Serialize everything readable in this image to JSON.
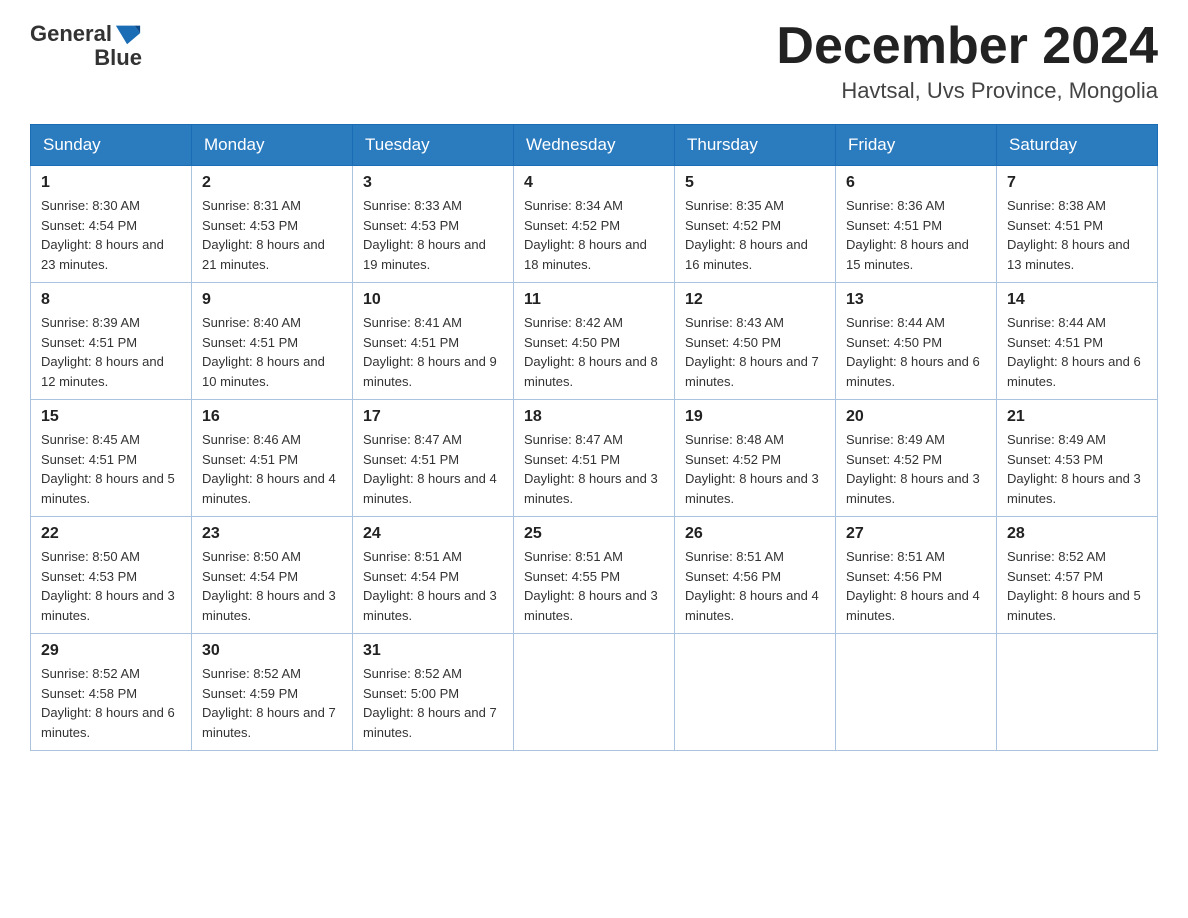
{
  "header": {
    "logo_text_general": "General",
    "logo_text_blue": "Blue",
    "month_title": "December 2024",
    "location": "Havtsal, Uvs Province, Mongolia"
  },
  "days_of_week": [
    "Sunday",
    "Monday",
    "Tuesday",
    "Wednesday",
    "Thursday",
    "Friday",
    "Saturday"
  ],
  "weeks": [
    [
      {
        "day": "1",
        "sunrise": "8:30 AM",
        "sunset": "4:54 PM",
        "daylight": "8 hours and 23 minutes."
      },
      {
        "day": "2",
        "sunrise": "8:31 AM",
        "sunset": "4:53 PM",
        "daylight": "8 hours and 21 minutes."
      },
      {
        "day": "3",
        "sunrise": "8:33 AM",
        "sunset": "4:53 PM",
        "daylight": "8 hours and 19 minutes."
      },
      {
        "day": "4",
        "sunrise": "8:34 AM",
        "sunset": "4:52 PM",
        "daylight": "8 hours and 18 minutes."
      },
      {
        "day": "5",
        "sunrise": "8:35 AM",
        "sunset": "4:52 PM",
        "daylight": "8 hours and 16 minutes."
      },
      {
        "day": "6",
        "sunrise": "8:36 AM",
        "sunset": "4:51 PM",
        "daylight": "8 hours and 15 minutes."
      },
      {
        "day": "7",
        "sunrise": "8:38 AM",
        "sunset": "4:51 PM",
        "daylight": "8 hours and 13 minutes."
      }
    ],
    [
      {
        "day": "8",
        "sunrise": "8:39 AM",
        "sunset": "4:51 PM",
        "daylight": "8 hours and 12 minutes."
      },
      {
        "day": "9",
        "sunrise": "8:40 AM",
        "sunset": "4:51 PM",
        "daylight": "8 hours and 10 minutes."
      },
      {
        "day": "10",
        "sunrise": "8:41 AM",
        "sunset": "4:51 PM",
        "daylight": "8 hours and 9 minutes."
      },
      {
        "day": "11",
        "sunrise": "8:42 AM",
        "sunset": "4:50 PM",
        "daylight": "8 hours and 8 minutes."
      },
      {
        "day": "12",
        "sunrise": "8:43 AM",
        "sunset": "4:50 PM",
        "daylight": "8 hours and 7 minutes."
      },
      {
        "day": "13",
        "sunrise": "8:44 AM",
        "sunset": "4:50 PM",
        "daylight": "8 hours and 6 minutes."
      },
      {
        "day": "14",
        "sunrise": "8:44 AM",
        "sunset": "4:51 PM",
        "daylight": "8 hours and 6 minutes."
      }
    ],
    [
      {
        "day": "15",
        "sunrise": "8:45 AM",
        "sunset": "4:51 PM",
        "daylight": "8 hours and 5 minutes."
      },
      {
        "day": "16",
        "sunrise": "8:46 AM",
        "sunset": "4:51 PM",
        "daylight": "8 hours and 4 minutes."
      },
      {
        "day": "17",
        "sunrise": "8:47 AM",
        "sunset": "4:51 PM",
        "daylight": "8 hours and 4 minutes."
      },
      {
        "day": "18",
        "sunrise": "8:47 AM",
        "sunset": "4:51 PM",
        "daylight": "8 hours and 3 minutes."
      },
      {
        "day": "19",
        "sunrise": "8:48 AM",
        "sunset": "4:52 PM",
        "daylight": "8 hours and 3 minutes."
      },
      {
        "day": "20",
        "sunrise": "8:49 AM",
        "sunset": "4:52 PM",
        "daylight": "8 hours and 3 minutes."
      },
      {
        "day": "21",
        "sunrise": "8:49 AM",
        "sunset": "4:53 PM",
        "daylight": "8 hours and 3 minutes."
      }
    ],
    [
      {
        "day": "22",
        "sunrise": "8:50 AM",
        "sunset": "4:53 PM",
        "daylight": "8 hours and 3 minutes."
      },
      {
        "day": "23",
        "sunrise": "8:50 AM",
        "sunset": "4:54 PM",
        "daylight": "8 hours and 3 minutes."
      },
      {
        "day": "24",
        "sunrise": "8:51 AM",
        "sunset": "4:54 PM",
        "daylight": "8 hours and 3 minutes."
      },
      {
        "day": "25",
        "sunrise": "8:51 AM",
        "sunset": "4:55 PM",
        "daylight": "8 hours and 3 minutes."
      },
      {
        "day": "26",
        "sunrise": "8:51 AM",
        "sunset": "4:56 PM",
        "daylight": "8 hours and 4 minutes."
      },
      {
        "day": "27",
        "sunrise": "8:51 AM",
        "sunset": "4:56 PM",
        "daylight": "8 hours and 4 minutes."
      },
      {
        "day": "28",
        "sunrise": "8:52 AM",
        "sunset": "4:57 PM",
        "daylight": "8 hours and 5 minutes."
      }
    ],
    [
      {
        "day": "29",
        "sunrise": "8:52 AM",
        "sunset": "4:58 PM",
        "daylight": "8 hours and 6 minutes."
      },
      {
        "day": "30",
        "sunrise": "8:52 AM",
        "sunset": "4:59 PM",
        "daylight": "8 hours and 7 minutes."
      },
      {
        "day": "31",
        "sunrise": "8:52 AM",
        "sunset": "5:00 PM",
        "daylight": "8 hours and 7 minutes."
      },
      null,
      null,
      null,
      null
    ]
  ],
  "labels": {
    "sunrise_prefix": "Sunrise: ",
    "sunset_prefix": "Sunset: ",
    "daylight_prefix": "Daylight: "
  }
}
